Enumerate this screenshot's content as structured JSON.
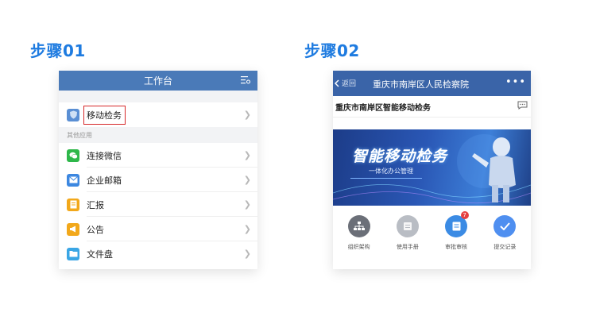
{
  "step1": {
    "title": "步骤01",
    "header_title": "工作台",
    "featured_item": "移动检务",
    "section_label": "其他应用",
    "items": [
      {
        "label": "连接微信",
        "icon": "wechat-icon",
        "color": "#2eb74a"
      },
      {
        "label": "企业邮箱",
        "icon": "mail-icon",
        "color": "#3c87e0"
      },
      {
        "label": "汇报",
        "icon": "report-icon",
        "color": "#f2a81b"
      },
      {
        "label": "公告",
        "icon": "megaphone-icon",
        "color": "#f2a81b"
      },
      {
        "label": "文件盘",
        "icon": "folder-icon",
        "color": "#3aa6e5"
      }
    ]
  },
  "step2": {
    "title": "步骤02",
    "back_label": "返回",
    "header_title": "重庆市南岸区人民检察院",
    "subtitle": "重庆市南岸区智能移动检务",
    "banner_title": "智能移动检务",
    "banner_subtitle": "一体化办公管理",
    "apps": [
      {
        "label": "组织架构",
        "icon": "org-chart-icon",
        "color": "#6b6f78"
      },
      {
        "label": "使用手册",
        "icon": "manual-icon",
        "color": "#b9bdc4"
      },
      {
        "label": "审批审核",
        "icon": "approval-icon",
        "color": "#3b8be4",
        "badge": "7"
      },
      {
        "label": "提交记录",
        "icon": "check-icon",
        "color": "#4f8ff0"
      }
    ]
  },
  "colors": {
    "step_title": "#1e7be0",
    "header_blue": "#4a7ab8",
    "highlight_red": "#d6282a"
  }
}
